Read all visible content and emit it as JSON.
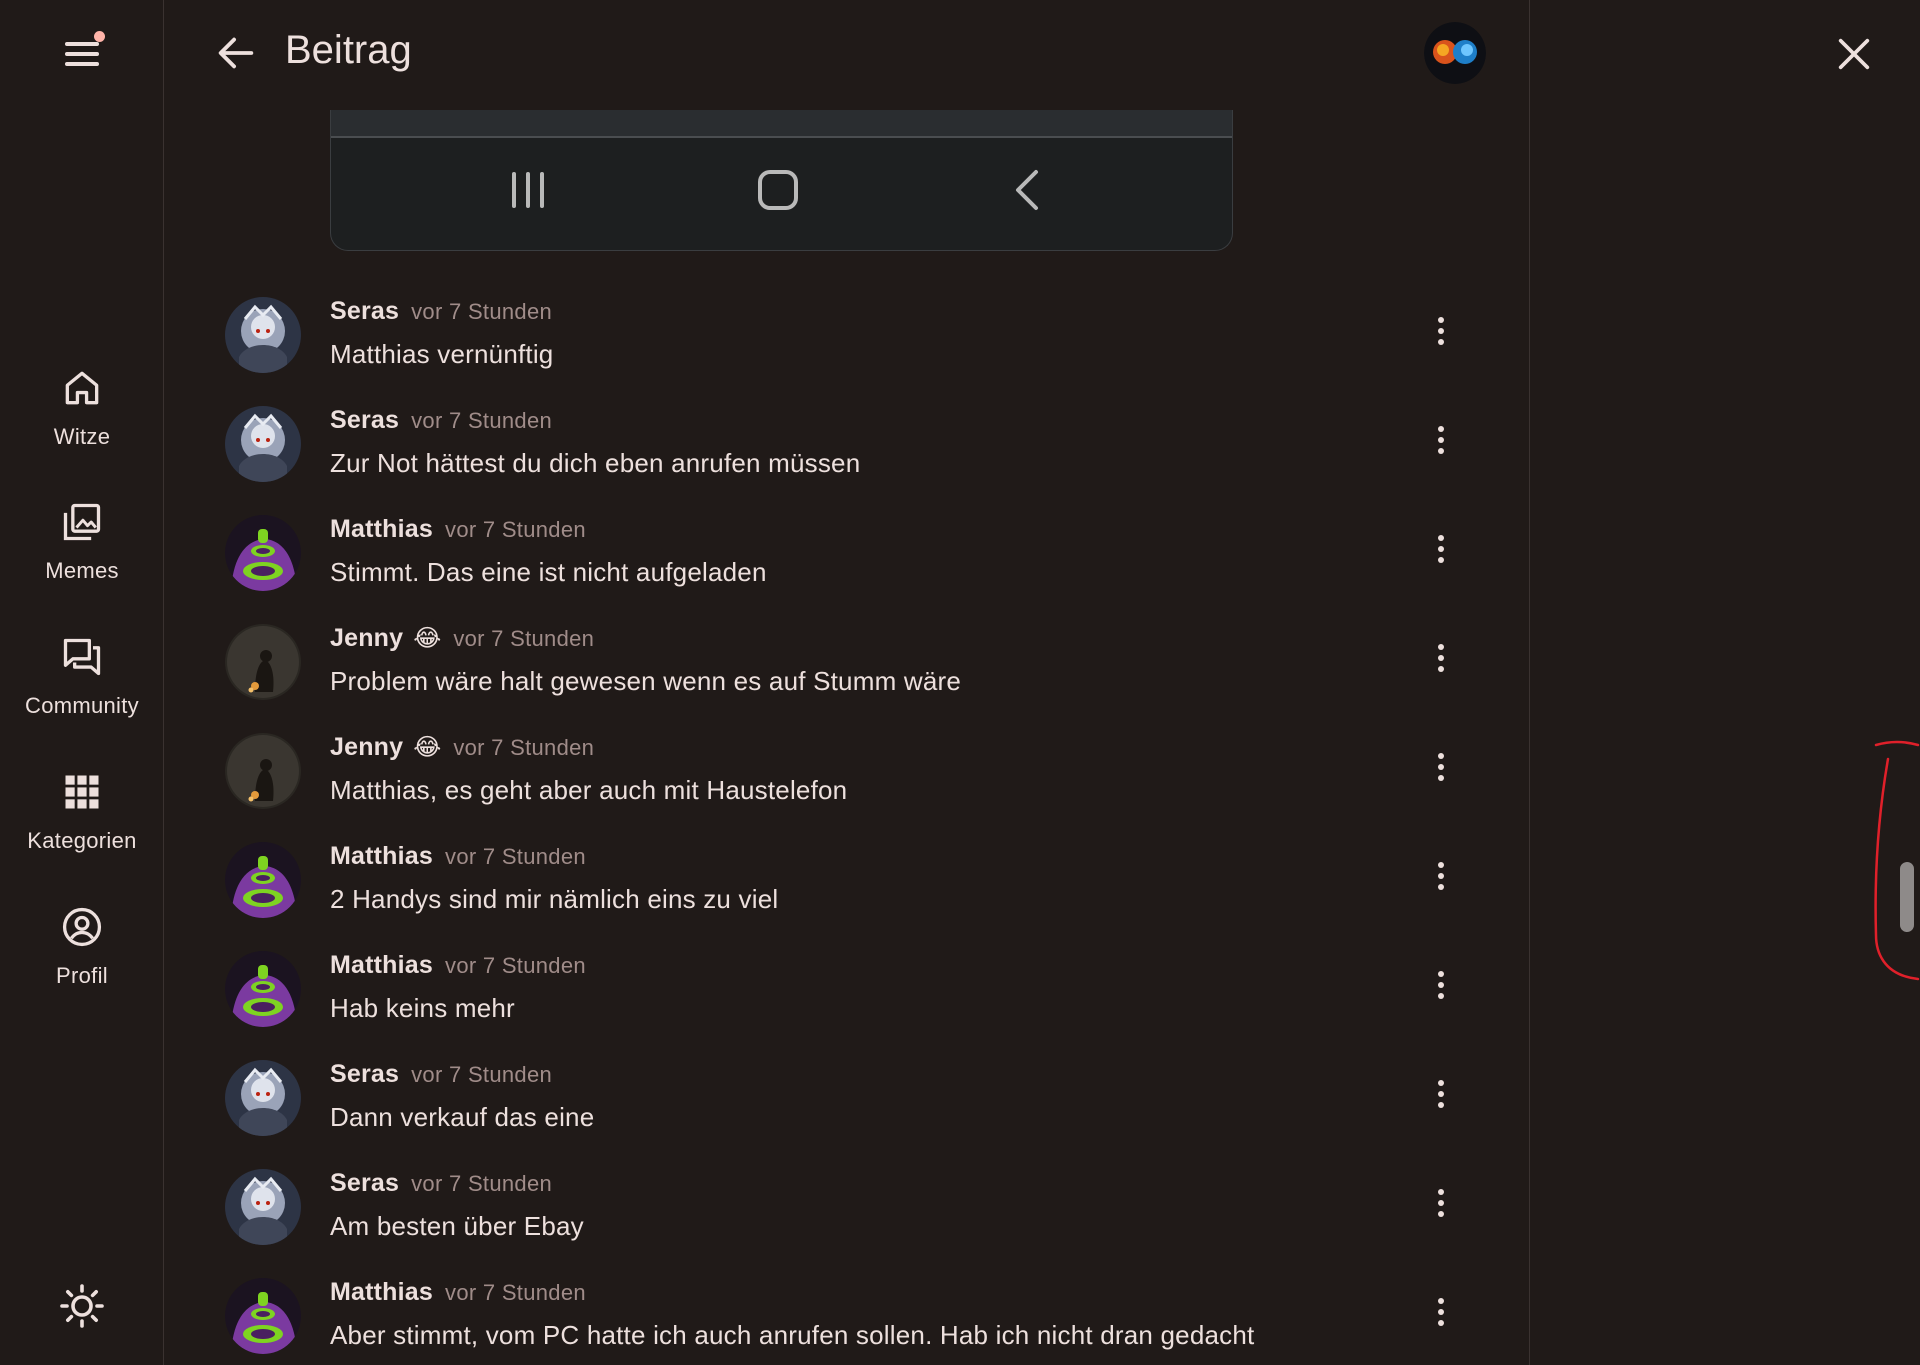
{
  "header": {
    "title": "Beitrag"
  },
  "sidebar": {
    "items": [
      {
        "label": "Witze",
        "icon": "home-icon"
      },
      {
        "label": "Memes",
        "icon": "images-icon"
      },
      {
        "label": "Community",
        "icon": "forum-icon"
      },
      {
        "label": "Kategorien",
        "icon": "grid-icon"
      },
      {
        "label": "Profil",
        "icon": "account-circle-icon"
      }
    ]
  },
  "comments": [
    {
      "author": "Seras",
      "emoji": "",
      "time": "vor 7 Stunden",
      "text": "Matthias vernünftig",
      "avatar": "seras"
    },
    {
      "author": "Seras",
      "emoji": "",
      "time": "vor 7 Stunden",
      "text": "Zur Not hättest du dich eben anrufen müssen",
      "avatar": "seras"
    },
    {
      "author": "Matthias",
      "emoji": "",
      "time": "vor 7 Stunden",
      "text": "Stimmt. Das eine ist nicht aufgeladen",
      "avatar": "matthias"
    },
    {
      "author": "Jenny",
      "emoji": "😂",
      "time": "vor 7 Stunden",
      "text": "Problem wäre halt gewesen wenn es auf Stumm wäre",
      "avatar": "jenny"
    },
    {
      "author": "Jenny",
      "emoji": "😂",
      "time": "vor 7 Stunden",
      "text": "Matthias, es geht aber auch mit Haustelefon",
      "avatar": "jenny"
    },
    {
      "author": "Matthias",
      "emoji": "",
      "time": "vor 7 Stunden",
      "text": "2 Handys sind mir nämlich eins zu viel",
      "avatar": "matthias"
    },
    {
      "author": "Matthias",
      "emoji": "",
      "time": "vor 7 Stunden",
      "text": "Hab keins mehr",
      "avatar": "matthias"
    },
    {
      "author": "Seras",
      "emoji": "",
      "time": "vor 7 Stunden",
      "text": "Dann verkauf das eine",
      "avatar": "seras"
    },
    {
      "author": "Seras",
      "emoji": "",
      "time": "vor 7 Stunden",
      "text": "Am besten über Ebay",
      "avatar": "seras"
    },
    {
      "author": "Matthias",
      "emoji": "",
      "time": "vor 7 Stunden",
      "text": "Aber stimmt, vom PC hatte ich auch anrufen sollen. Hab ich nicht dran gedacht",
      "avatar": "matthias"
    }
  ],
  "colors": {
    "background": "#201a18",
    "text": "#ede0dd",
    "muted_text": "#a08c89",
    "notification_dot": "#ffb4a9",
    "annotation": "#e0202a"
  }
}
